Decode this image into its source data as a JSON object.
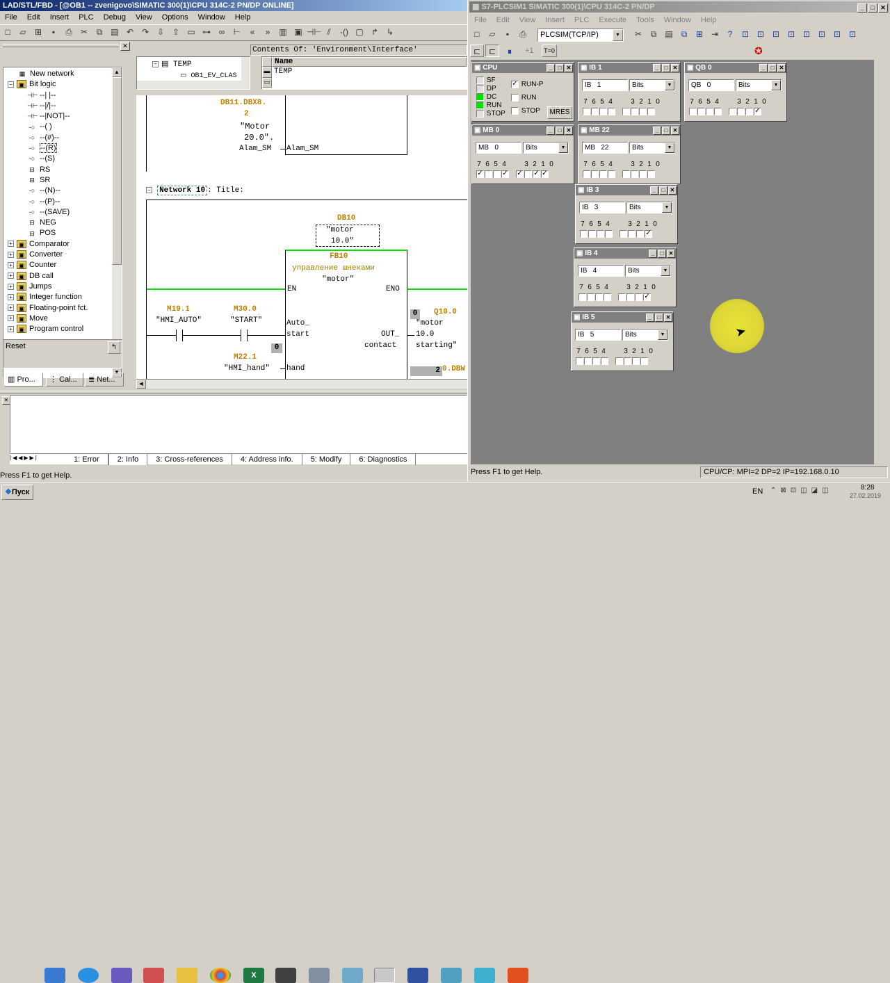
{
  "lad": {
    "title": "LAD/STL/FBD  - [@OB1 -- zvenigovo\\SIMATIC 300(1)\\CPU 314C-2 PN/DP  ONLINE]",
    "menu": [
      "File",
      "Edit",
      "Insert",
      "PLC",
      "Debug",
      "View",
      "Options",
      "Window",
      "Help"
    ],
    "catalog": {
      "items": [
        {
          "label": "New network",
          "icon": "new-network-icon",
          "indent": 1
        },
        {
          "label": "Bit logic",
          "icon": "folder-icon",
          "indent": 0,
          "expanded": true
        },
        {
          "label": "--| |--",
          "icon": "contact-no-icon",
          "indent": 2
        },
        {
          "label": "--|/|--",
          "icon": "contact-nc-icon",
          "indent": 2
        },
        {
          "label": "--|NOT|--",
          "icon": "not-icon",
          "indent": 2
        },
        {
          "label": "--( )",
          "icon": "coil-icon",
          "indent": 2
        },
        {
          "label": "--(#)--",
          "icon": "coil-icon",
          "indent": 2
        },
        {
          "label": "--(R)",
          "icon": "coil-icon",
          "indent": 2,
          "selected": true
        },
        {
          "label": "--(S)",
          "icon": "coil-icon",
          "indent": 2
        },
        {
          "label": "RS",
          "icon": "box-icon",
          "indent": 2
        },
        {
          "label": "SR",
          "icon": "box-icon",
          "indent": 2
        },
        {
          "label": "--(N)--",
          "icon": "coil-icon",
          "indent": 2
        },
        {
          "label": "--(P)--",
          "icon": "coil-icon",
          "indent": 2
        },
        {
          "label": "--(SAVE)",
          "icon": "coil-icon",
          "indent": 2
        },
        {
          "label": "NEG",
          "icon": "box-icon",
          "indent": 2
        },
        {
          "label": "POS",
          "icon": "box-icon",
          "indent": 2
        },
        {
          "label": "Comparator",
          "icon": "folder-icon",
          "indent": 0
        },
        {
          "label": "Converter",
          "icon": "folder-icon",
          "indent": 0
        },
        {
          "label": "Counter",
          "icon": "folder-icon",
          "indent": 0
        },
        {
          "label": "DB call",
          "icon": "folder-icon",
          "indent": 0
        },
        {
          "label": "Jumps",
          "icon": "folder-icon",
          "indent": 0
        },
        {
          "label": "Integer function",
          "icon": "folder-icon",
          "indent": 0
        },
        {
          "label": "Floating-point fct.",
          "icon": "folder-icon",
          "indent": 0
        },
        {
          "label": "Move",
          "icon": "folder-icon",
          "indent": 0
        },
        {
          "label": "Program control",
          "icon": "folder-icon",
          "indent": 0
        }
      ],
      "status_text": "Reset",
      "tabs": [
        "Pro...",
        "Cal...",
        "Net..."
      ]
    },
    "interface": {
      "tree_root": "TEMP",
      "tree_child": "OB1_EV_CLAS",
      "contents_title": "Contents Of: 'Environment\\Interface'",
      "column_name": "Name",
      "row_value": "TEMP"
    },
    "network9": {
      "db_address": "DB11.DBX8.",
      "db_address2": "2",
      "symbol1": "\"Motor",
      "symbol2": "20.0\".",
      "alarm_left": "Alam_SM",
      "alarm_right": "Alam_SM"
    },
    "network10": {
      "label": "Network 10",
      "title_suffix": ": Title:",
      "db_name": "DB10",
      "db_symbol1": "\"motor",
      "db_symbol2": "10.0\"",
      "fb_name": "FB10",
      "fb_comment": "управление шнеками",
      "fb_symbol": "\"motor\"",
      "en": "EN",
      "eno": "ENO",
      "c1_addr": "M19.1",
      "c1_sym": "\"HMI_AUTO\"",
      "c2_addr": "M30.0",
      "c2_sym": "\"START\"",
      "pin_auto1": "Auto_",
      "pin_auto2": "start",
      "val0a": "0",
      "c3_addr": "M22.1",
      "c3_sym": "\"HMI_hand\"",
      "pin_hand": "hand",
      "out_pin1": "OUT_",
      "out_pin2": "contact",
      "out_val": "0",
      "q_addr": "Q10.0",
      "q_sym1": "\"motor",
      "q_sym2": "10.0",
      "q_sym3": "starting\"",
      "val2": "2",
      "dbw": "0.DBW"
    },
    "bottom_tabs": [
      "1: Error",
      "2: Info",
      "3: Cross-references",
      "4: Address info.",
      "5: Modify",
      "6: Diagnostics"
    ],
    "status": "Press F1 to get Help."
  },
  "plcsim": {
    "title": "S7-PLCSIM1    SIMATIC 300(1)\\CPU 314C-2 PN/DP",
    "menu": [
      "File",
      "Edit",
      "View",
      "Insert",
      "PLC",
      "Execute",
      "Tools",
      "Window",
      "Help"
    ],
    "connection": "PLCSIM(TCP/IP)",
    "toolbar2_label": "T=0",
    "toolbar2_step": "+1",
    "cpu": {
      "title": "CPU",
      "leds": [
        "SF",
        "DP",
        "DC",
        "RUN",
        "STOP"
      ],
      "runp": "RUN-P",
      "run": "RUN",
      "stop": "STOP",
      "mres": "MRES"
    },
    "windows": [
      {
        "title": "IB    1",
        "area": "IB",
        "num": "1",
        "fmt": "Bits",
        "checked": []
      },
      {
        "title": "QB    0",
        "area": "QB",
        "num": "0",
        "fmt": "Bits",
        "checked": [
          0
        ]
      },
      {
        "title": "MB    0",
        "area": "MB",
        "num": "0",
        "fmt": "Bits",
        "checked": [
          7,
          4,
          3,
          1,
          0
        ]
      },
      {
        "title": "MB   22",
        "area": "MB",
        "num": "22",
        "fmt": "Bits",
        "checked": []
      },
      {
        "title": "IB    3",
        "area": "IB",
        "num": "3",
        "fmt": "Bits",
        "checked": [
          0
        ]
      },
      {
        "title": "IB    4",
        "area": "IB",
        "num": "4",
        "fmt": "Bits",
        "checked": [
          0
        ]
      },
      {
        "title": "IB    5",
        "area": "IB",
        "num": "5",
        "fmt": "Bits",
        "checked": []
      }
    ],
    "status_left": "Press F1 to get Help.",
    "status_right": "CPU/CP:  MPI=2 DP=2 IP=192.168.0.10"
  },
  "taskbar": {
    "start": "Пуск",
    "lang": "EN",
    "time": "8:28",
    "date": "27.02.2019"
  }
}
